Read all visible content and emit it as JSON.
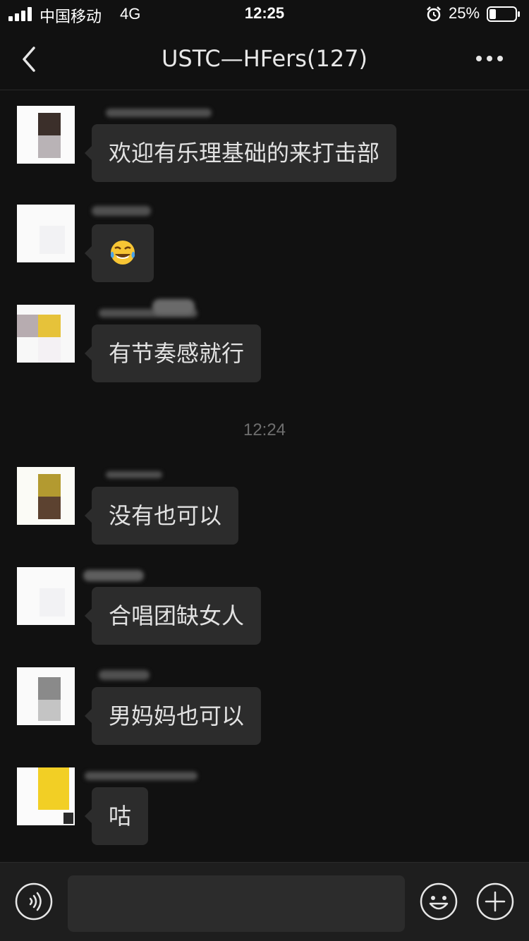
{
  "status_bar": {
    "carrier": "中国移动",
    "network": "4G",
    "time": "12:25",
    "battery_percent": "25%",
    "battery_level": 0.25,
    "icons": [
      "signal-icon",
      "alarm-icon",
      "battery-icon"
    ]
  },
  "nav": {
    "title": "USTC—HFers(127)",
    "icons": [
      "back-icon",
      "more-icon"
    ]
  },
  "messages_before": [
    {
      "text": "欢迎有乐理基础的来打击部"
    },
    {
      "emoji": "face-with-tears-of-joy",
      "emoji_char": "😂"
    },
    {
      "text": "有节奏感就行"
    }
  ],
  "time_divider": "12:24",
  "messages_after": [
    {
      "text": "没有也可以"
    },
    {
      "text": "合唱团缺女人"
    },
    {
      "text": "男妈妈也可以"
    },
    {
      "text": "咕"
    }
  ],
  "input_bar": {
    "message_value": "",
    "icons": [
      "voice-icon",
      "emoji-icon",
      "plus-icon"
    ]
  },
  "colors": {
    "background": "#111111",
    "bubble": "#2c2c2c",
    "text": "#e2e2e2",
    "timestamp": "#6e6e6e",
    "input_bar": "#1e1e1e"
  }
}
